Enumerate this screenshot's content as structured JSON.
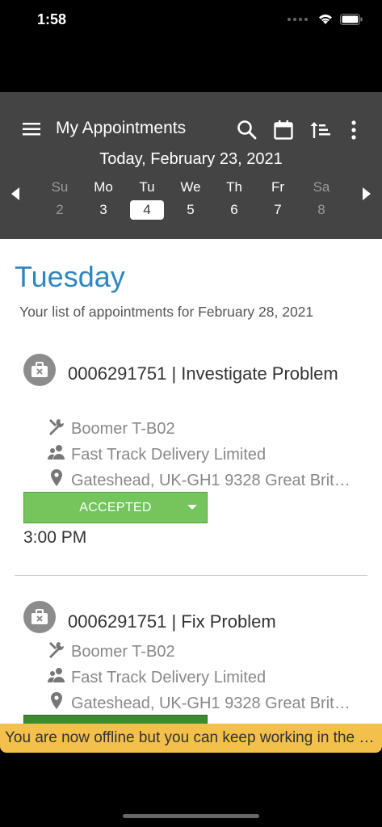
{
  "status_bar": {
    "time": "1:58"
  },
  "header": {
    "title": "My Appointments",
    "date_title": "Today, February 23, 2021"
  },
  "week": {
    "days": [
      {
        "name": "Su",
        "num": "2"
      },
      {
        "name": "Mo",
        "num": "3"
      },
      {
        "name": "Tu",
        "num": "4"
      },
      {
        "name": "We",
        "num": "5"
      },
      {
        "name": "Th",
        "num": "6"
      },
      {
        "name": "Fr",
        "num": "7"
      },
      {
        "name": "Sa",
        "num": "8"
      }
    ]
  },
  "main": {
    "day_heading": "Tuesday",
    "subtitle": "Your list of appointments for February 28, 2021",
    "appointments": [
      {
        "title": "0006291751 | Investigate Problem",
        "equipment": "Boomer T-B02",
        "customer": "Fast Track Delivery Limited",
        "location": "Gateshead, UK-GH1 9328 Great Brit…",
        "status": "ACCEPTED",
        "time": "3:00 PM"
      },
      {
        "title": "0006291751 | Fix Problem",
        "equipment": "Boomer T-B02",
        "customer": "Fast Track Delivery Limited",
        "location": "Gateshead, UK-GH1 9328 Great Brit…"
      }
    ]
  },
  "offline_banner": "You are now offline but you can keep working in the app",
  "colors": {
    "header_bg": "#444444",
    "heading_blue": "#2f86c0",
    "accepted_green": "#73c55c",
    "banner_yellow": "#f2c04b"
  }
}
